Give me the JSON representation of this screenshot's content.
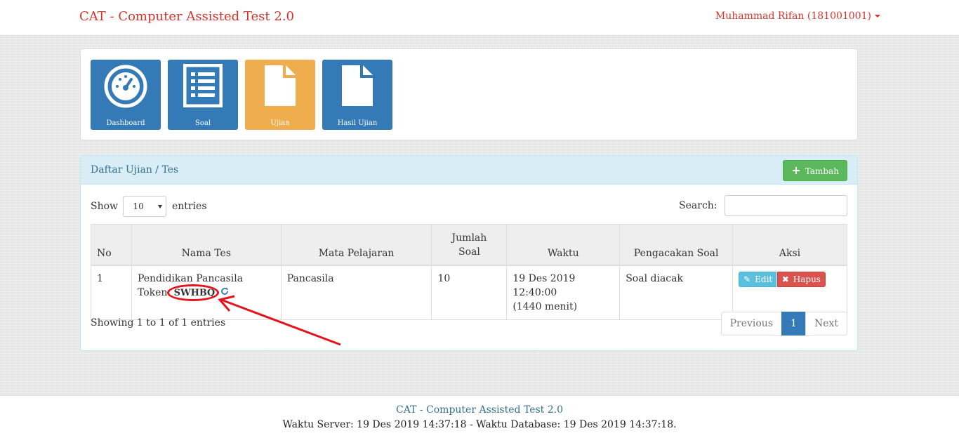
{
  "navbar": {
    "brand": "CAT - Computer Assisted Test 2.0",
    "user": "Muhammad Rifan (181001001)"
  },
  "tiles": [
    {
      "label": "Dashboard",
      "icon": "dashboard-gauge-icon",
      "color": "#337ab7"
    },
    {
      "label": "Soal",
      "icon": "list-icon",
      "color": "#337ab7"
    },
    {
      "label": "Ujian",
      "icon": "file-icon",
      "color": "#f0ad4e"
    },
    {
      "label": "Hasil Ujian",
      "icon": "file-icon",
      "color": "#337ab7"
    }
  ],
  "panel": {
    "title": "Daftar Ujian / Tes",
    "add_label": "Tambah",
    "show_label": "Show",
    "entries_value": "10",
    "entries_label": "entries",
    "search_label": "Search:",
    "search_value": ""
  },
  "table": {
    "headers": [
      "No",
      "Nama Tes",
      "Mata Pelajaran",
      "Jumlah Soal",
      "Waktu",
      "Pengacakan Soal",
      "Aksi"
    ],
    "rows": [
      {
        "no": "1",
        "nama": "Pendidikan Pancasila",
        "token_label": "Token:",
        "token": "SWHBQ",
        "mapel": "Pancasila",
        "jumlah": "10",
        "waktu_tanggal": "19 Des 2019 12:40:00",
        "waktu_durasi": "(1440 menit)",
        "acak": "Soal diacak",
        "edit_label": "Edit",
        "delete_label": "Hapus"
      }
    ]
  },
  "info": "Showing 1 to 1 of 1 entries",
  "pagination": {
    "previous": "Previous",
    "current": "1",
    "next": "Next"
  },
  "footer": {
    "title": "CAT - Computer Assisted Test 2.0",
    "time": "Waktu Server: 19 Des 2019 14:37:18 - Waktu Database: 19 Des 2019 14:37:18."
  },
  "colors": {
    "brand": "#d9342b",
    "primary": "#337ab7",
    "warning": "#f0ad4e",
    "success": "#5cb85c",
    "info": "#5bc0de",
    "danger": "#d9534f",
    "annotation": "#e3141c"
  }
}
